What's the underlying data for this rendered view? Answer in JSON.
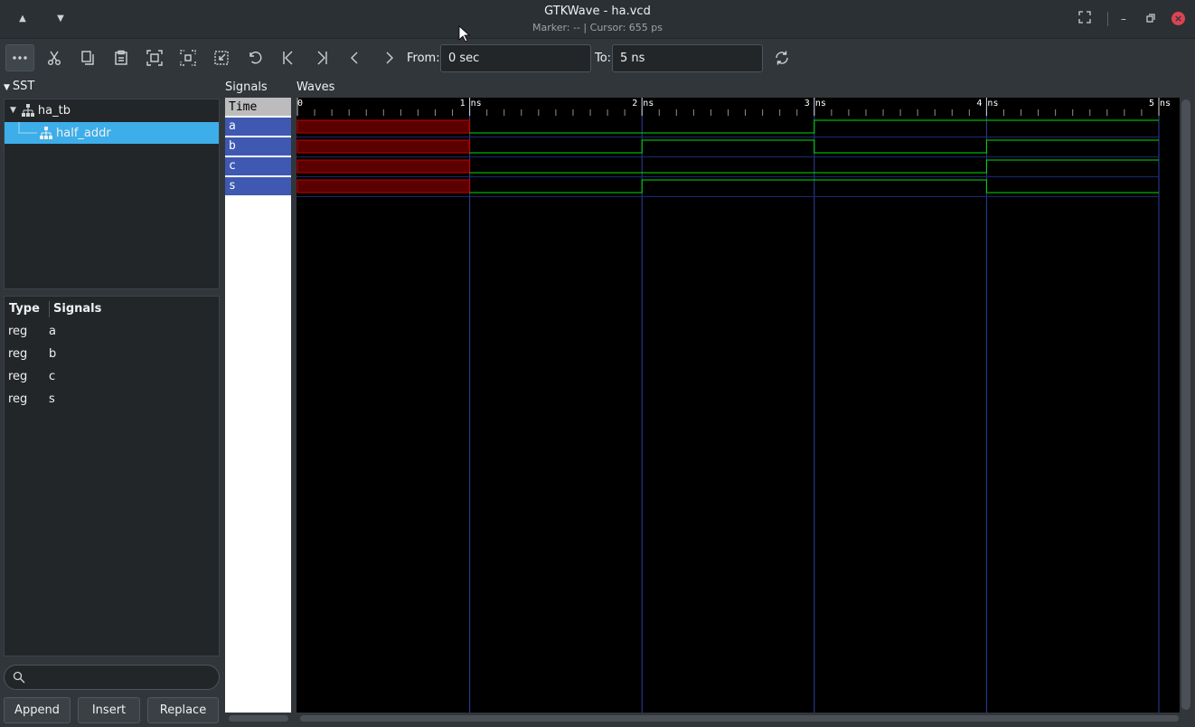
{
  "window": {
    "title": "GTKWave - ha.vcd",
    "subtitle": "Marker: --  |  Cursor: 655 ps"
  },
  "toolbar": {
    "from_label": "From:",
    "from_value": "0 sec",
    "to_label": "To:",
    "to_value": "5 ns"
  },
  "sst": {
    "header": "SST",
    "tree": [
      {
        "label": "ha_tb",
        "selected": false
      },
      {
        "label": "half_addr",
        "selected": true
      }
    ]
  },
  "signal_list": {
    "col_type": "Type",
    "col_signals": "Signals",
    "rows": [
      {
        "type": "reg",
        "name": "a"
      },
      {
        "type": "reg",
        "name": "b"
      },
      {
        "type": "reg",
        "name": "c"
      },
      {
        "type": "reg",
        "name": "s"
      }
    ]
  },
  "buttons": {
    "append": "Append",
    "insert": "Insert",
    "replace": "Replace"
  },
  "waves": {
    "signals_title": "Signals",
    "waves_title": "Waves",
    "time_label": "Time",
    "tick_labels": [
      "0",
      "1 ns",
      "2 ns",
      "3 ns",
      "4 ns",
      "5 ns"
    ],
    "time_range_ns": [
      0,
      5
    ],
    "undefined_until_ns": 1,
    "traces": [
      {
        "name": "a",
        "changes": [
          [
            1,
            0
          ],
          [
            3,
            1
          ]
        ]
      },
      {
        "name": "b",
        "changes": [
          [
            1,
            0
          ],
          [
            2,
            1
          ],
          [
            3,
            0
          ],
          [
            4,
            1
          ]
        ]
      },
      {
        "name": "c",
        "changes": [
          [
            1,
            0
          ],
          [
            4,
            1
          ]
        ]
      },
      {
        "name": "s",
        "changes": [
          [
            1,
            0
          ],
          [
            2,
            1
          ],
          [
            4,
            0
          ]
        ]
      }
    ],
    "colors": {
      "undefined": "#c80000",
      "trace": "#00e000",
      "grid": "#3040a0"
    }
  }
}
